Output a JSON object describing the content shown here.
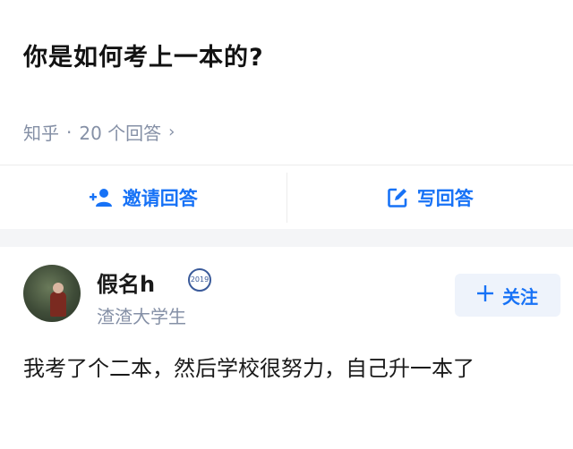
{
  "question": {
    "title": "你是如何考上一本的?",
    "source": "知乎",
    "separator": "·",
    "answer_count": "20 个回答",
    "chevron": "›"
  },
  "actions": {
    "invite_label": "邀请回答",
    "invite_icon": "add-user-icon",
    "write_label": "写回答",
    "write_icon": "edit-icon"
  },
  "author": {
    "name": "假名h",
    "badge_text": "2019",
    "description": "渣渣大学生",
    "follow_label": "关注",
    "follow_icon": "plus-icon"
  },
  "answer": {
    "text": "我考了个二本，然后学校很努力，自己升一本了"
  },
  "colors": {
    "accent": "#1772f6",
    "muted": "#8590a6",
    "band": "#f4f5f7"
  }
}
